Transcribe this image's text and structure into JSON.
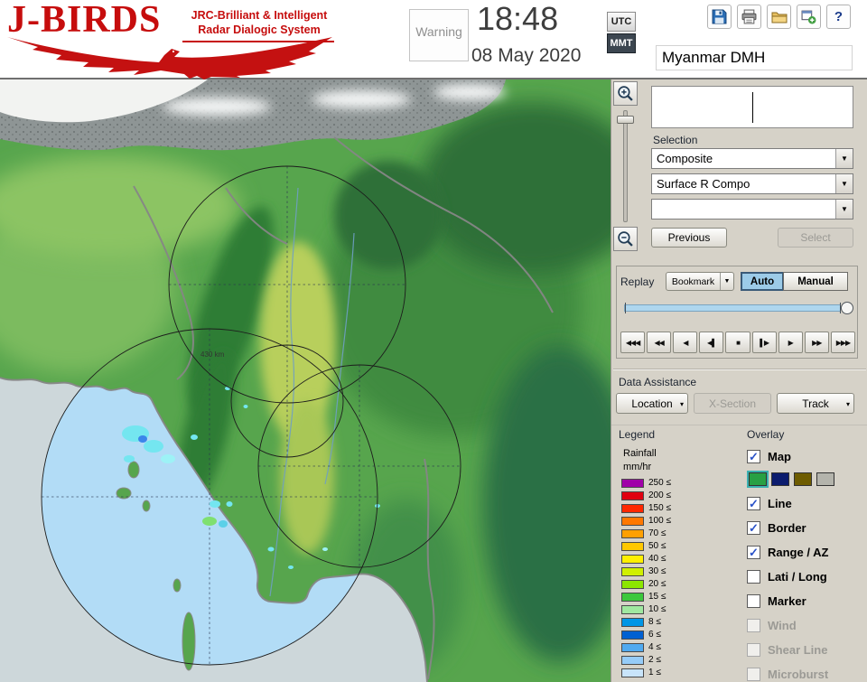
{
  "header": {
    "logo": {
      "title": "J-BIRDS",
      "subtitle_line1": "JRC-Brilliant & Intelligent",
      "subtitle_line2": "Radar  Dialogic  System"
    },
    "warning_button": "Warning",
    "clock": {
      "time": "18:48",
      "date": "08 May 2020"
    },
    "timezone": {
      "utc": "UTC",
      "mmt": "MMT",
      "selected": "MMT"
    },
    "station_name": "Myanmar DMH",
    "help_label": "?"
  },
  "icons": {
    "dropdown_arrow": "▼",
    "small_arrow": "▾",
    "check": "✓"
  },
  "map": {
    "range_label": "430 km"
  },
  "panel": {
    "selection": {
      "label": "Selection",
      "dropdowns": [
        "Composite",
        "Surface R Compo",
        ""
      ],
      "previous_button": "Previous",
      "select_button": "Select"
    },
    "replay": {
      "label": "Replay",
      "bookmark_button": "Bookmark",
      "auto_button": "Auto",
      "manual_button": "Manual",
      "playback_buttons": [
        "◀◀◀",
        "◀◀",
        "◀",
        "◀▌",
        "■",
        "▌▶",
        "▶",
        "▶▶",
        "▶▶▶"
      ]
    },
    "data_assistance": {
      "label": "Data Assistance",
      "location_button": "Location",
      "xsection_button": "X-Section",
      "track_button": "Track"
    },
    "legend": {
      "label": "Legend",
      "unit_line1": "Rainfall",
      "unit_line2": "mm/hr",
      "suffix": "≤",
      "rows": [
        {
          "value": "250",
          "color": "#a000a8"
        },
        {
          "value": "200",
          "color": "#e00010"
        },
        {
          "value": "150",
          "color": "#ff2800"
        },
        {
          "value": "100",
          "color": "#ff7800"
        },
        {
          "value": "70",
          "color": "#ffa000"
        },
        {
          "value": "50",
          "color": "#ffc800"
        },
        {
          "value": "40",
          "color": "#fff000"
        },
        {
          "value": "30",
          "color": "#d0f000"
        },
        {
          "value": "20",
          "color": "#8ce600"
        },
        {
          "value": "15",
          "color": "#3cc83c"
        },
        {
          "value": "10",
          "color": "#a0e8a0"
        },
        {
          "value": "8",
          "color": "#0096e6"
        },
        {
          "value": "6",
          "color": "#0060d2"
        },
        {
          "value": "4",
          "color": "#50aaf0"
        },
        {
          "value": "2",
          "color": "#96ccf8"
        },
        {
          "value": "1",
          "color": "#c8e4fa"
        }
      ]
    },
    "overlay": {
      "label": "Overlay",
      "map_swatches": [
        "#28a044",
        "#0c1c6e",
        "#6e5c00",
        "#b4b4ac"
      ],
      "items": [
        {
          "label": "Map",
          "checked": true,
          "enabled": true
        },
        {
          "label": "Line",
          "checked": true,
          "enabled": true
        },
        {
          "label": "Border",
          "checked": true,
          "enabled": true
        },
        {
          "label": "Range / AZ",
          "checked": true,
          "enabled": true
        },
        {
          "label": "Lati / Long",
          "checked": false,
          "enabled": true
        },
        {
          "label": "Marker",
          "checked": false,
          "enabled": true
        },
        {
          "label": "Wind",
          "checked": false,
          "enabled": false
        },
        {
          "label": "Shear Line",
          "checked": false,
          "enabled": false
        },
        {
          "label": "Microburst",
          "checked": false,
          "enabled": false
        }
      ]
    }
  }
}
